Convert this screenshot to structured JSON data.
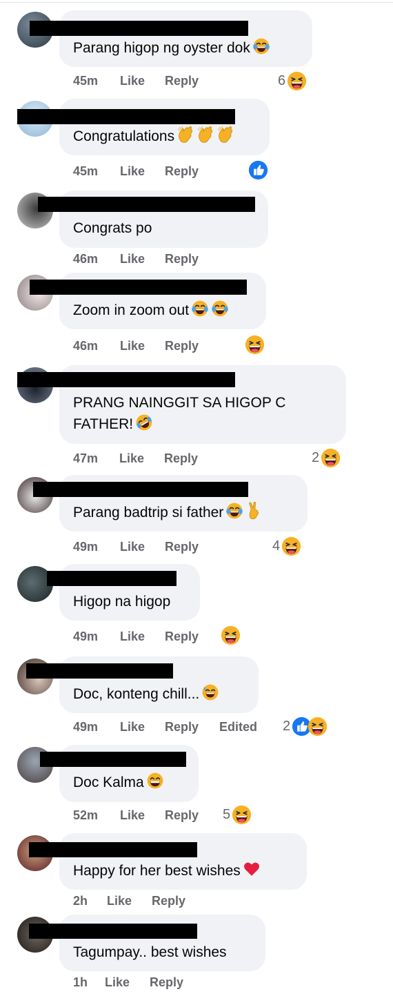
{
  "actions": {
    "like": "Like",
    "reply": "Reply",
    "edited": "Edited"
  },
  "colors": {
    "bubble": "#f0f2f5",
    "meta": "#65676b",
    "like_blue": "#1877f2",
    "heart": "#e41e3f",
    "haha_yellow": "#f7b125"
  },
  "comments": [
    {
      "text": "Parang higop ng oyster dok",
      "emoji": [
        "tears-of-joy-emoji"
      ],
      "time": "45m",
      "reaction_count": "6",
      "reactions": [
        "haha-reaction-icon"
      ]
    },
    {
      "text": "Congratulations",
      "emoji": [
        "clapping-hands-emoji",
        "clapping-hands-emoji",
        "clapping-hands-emoji"
      ],
      "time": "45m",
      "reaction_count": "",
      "reactions": [
        "like-reaction-icon"
      ]
    },
    {
      "text": "Congrats po",
      "emoji": [],
      "time": "46m",
      "reaction_count": "",
      "reactions": []
    },
    {
      "text": "Zoom in zoom out",
      "emoji": [
        "tears-of-joy-emoji",
        "tears-of-joy-emoji"
      ],
      "time": "46m",
      "reaction_count": "",
      "reactions": [
        "haha-reaction-icon"
      ]
    },
    {
      "text": "PRANG NAINGGIT SA HIGOP C",
      "text2": "FATHER!",
      "emoji": [
        "rolling-laughing-emoji"
      ],
      "time": "47m",
      "reaction_count": "2",
      "reactions": [
        "haha-reaction-icon"
      ]
    },
    {
      "text": "Parang badtrip si father",
      "emoji": [
        "tears-of-joy-emoji",
        "victory-hand-emoji"
      ],
      "time": "49m",
      "reaction_count": "4",
      "reactions": [
        "haha-reaction-icon"
      ]
    },
    {
      "text": "Higop na higop",
      "emoji": [],
      "time": "49m",
      "reaction_count": "",
      "reactions": [
        "haha-reaction-icon"
      ]
    },
    {
      "text": "Doc, konteng chill...",
      "emoji": [
        "sweat-smile-emoji"
      ],
      "time": "49m",
      "edited": true,
      "reaction_count": "2",
      "reactions": [
        "like-reaction-icon",
        "haha-reaction-icon"
      ]
    },
    {
      "text": "Doc Kalma",
      "emoji": [
        "grinning-emoji"
      ],
      "time": "52m",
      "reaction_count": "5",
      "reactions": [
        "haha-reaction-icon"
      ]
    },
    {
      "text": "Happy for her best wishes",
      "emoji": [
        "red-heart-emoji"
      ],
      "time": "2h",
      "reaction_count": "",
      "reactions": []
    },
    {
      "text": "Tagumpay.. best wishes",
      "emoji": [],
      "time": "1h",
      "reaction_count": "",
      "reactions": []
    }
  ]
}
